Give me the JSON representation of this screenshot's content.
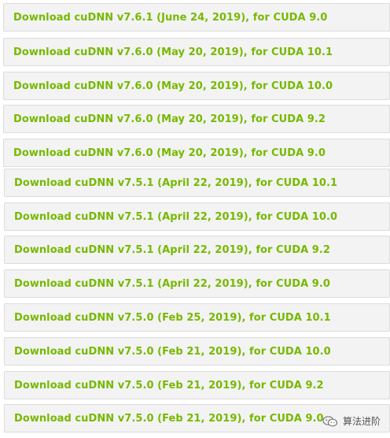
{
  "downloads": [
    {
      "label": "Download cuDNN v7.6.1 (June 24, 2019), for CUDA 9.0"
    },
    {
      "label": "Download cuDNN v7.6.0 (May 20, 2019), for CUDA 10.1"
    },
    {
      "label": "Download cuDNN v7.6.0 (May 20, 2019), for CUDA 10.0"
    },
    {
      "label": "Download cuDNN v7.6.0 (May 20, 2019), for CUDA 9.2"
    },
    {
      "label": "Download cuDNN v7.6.0 (May 20, 2019), for CUDA 9.0"
    },
    {
      "label": "Download cuDNN v7.5.1 (April 22, 2019), for CUDA 10.1"
    },
    {
      "label": "Download cuDNN v7.5.1 (April 22, 2019), for CUDA 10.0"
    },
    {
      "label": "Download cuDNN v7.5.1 (April 22, 2019), for CUDA 9.2"
    },
    {
      "label": "Download cuDNN v7.5.1 (April 22, 2019), for CUDA 9.0"
    },
    {
      "label": "Download cuDNN v7.5.0 (Feb 25, 2019), for CUDA 10.1"
    },
    {
      "label": "Download cuDNN v7.5.0 (Feb 21, 2019), for CUDA 10.0"
    },
    {
      "label": "Download cuDNN v7.5.0 (Feb 21, 2019), for CUDA 9.2"
    },
    {
      "label": "Download cuDNN v7.5.0 (Feb 21, 2019), for CUDA 9.0"
    }
  ],
  "watermark": {
    "text": "算法进阶",
    "icon": "wechat-icon"
  },
  "colors": {
    "link": "#76b900",
    "row_background": "#f3f3f3",
    "row_border": "#dcdcdc"
  }
}
